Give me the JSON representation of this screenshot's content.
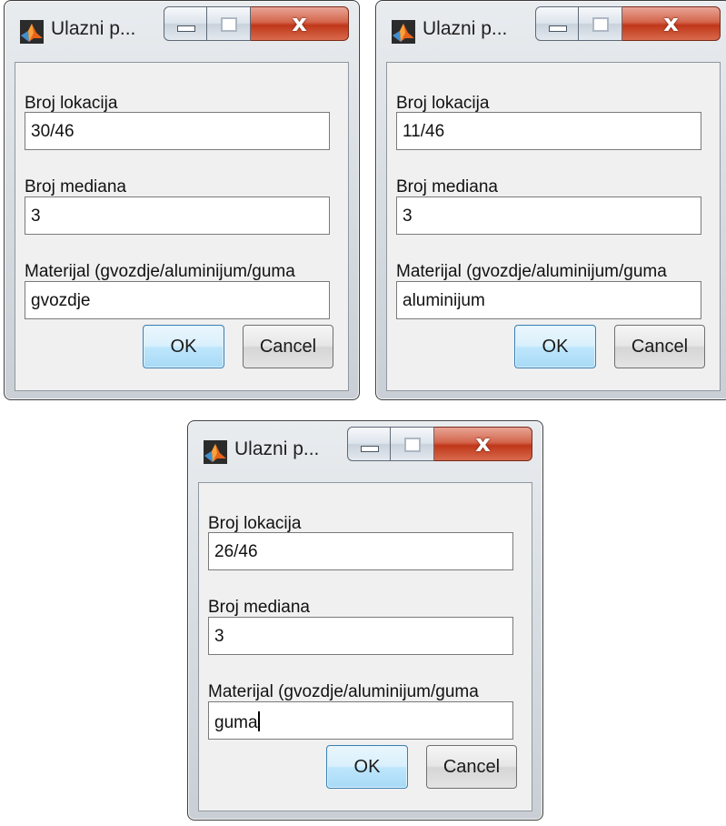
{
  "dialogs": [
    {
      "title": "Ulazni p...",
      "close_symbol": "x",
      "fields": [
        {
          "label": "Broj lokacija",
          "value": "30/46"
        },
        {
          "label": "Broj mediana",
          "value": "3"
        },
        {
          "label": "Materijal (gvozdje/aluminijum/guma",
          "value": "gvozdje"
        }
      ],
      "ok_label": "OK",
      "cancel_label": "Cancel"
    },
    {
      "title": "Ulazni p...",
      "close_symbol": "x",
      "fields": [
        {
          "label": "Broj lokacija",
          "value": "11/46"
        },
        {
          "label": "Broj mediana",
          "value": "3"
        },
        {
          "label": "Materijal (gvozdje/aluminijum/guma",
          "value": "aluminijum"
        }
      ],
      "ok_label": "OK",
      "cancel_label": "Cancel"
    },
    {
      "title": "Ulazni p...",
      "close_symbol": "x",
      "fields": [
        {
          "label": "Broj lokacija",
          "value": "26/46"
        },
        {
          "label": "Broj mediana",
          "value": "3"
        },
        {
          "label": "Materijal (gvozdje/aluminijum/guma",
          "value": "guma"
        }
      ],
      "ok_label": "OK",
      "cancel_label": "Cancel"
    }
  ],
  "colors": {
    "ok_button_border": "#3c7fb1",
    "close_button_red": "#c0371a",
    "matlab_icon_orange": "#e8621a"
  },
  "icons": {
    "app": "matlab-icon",
    "minimize": "minimize-icon",
    "maximize": "maximize-icon",
    "close": "close-icon"
  },
  "focused_field": {
    "dialog": 2,
    "field": 2
  }
}
